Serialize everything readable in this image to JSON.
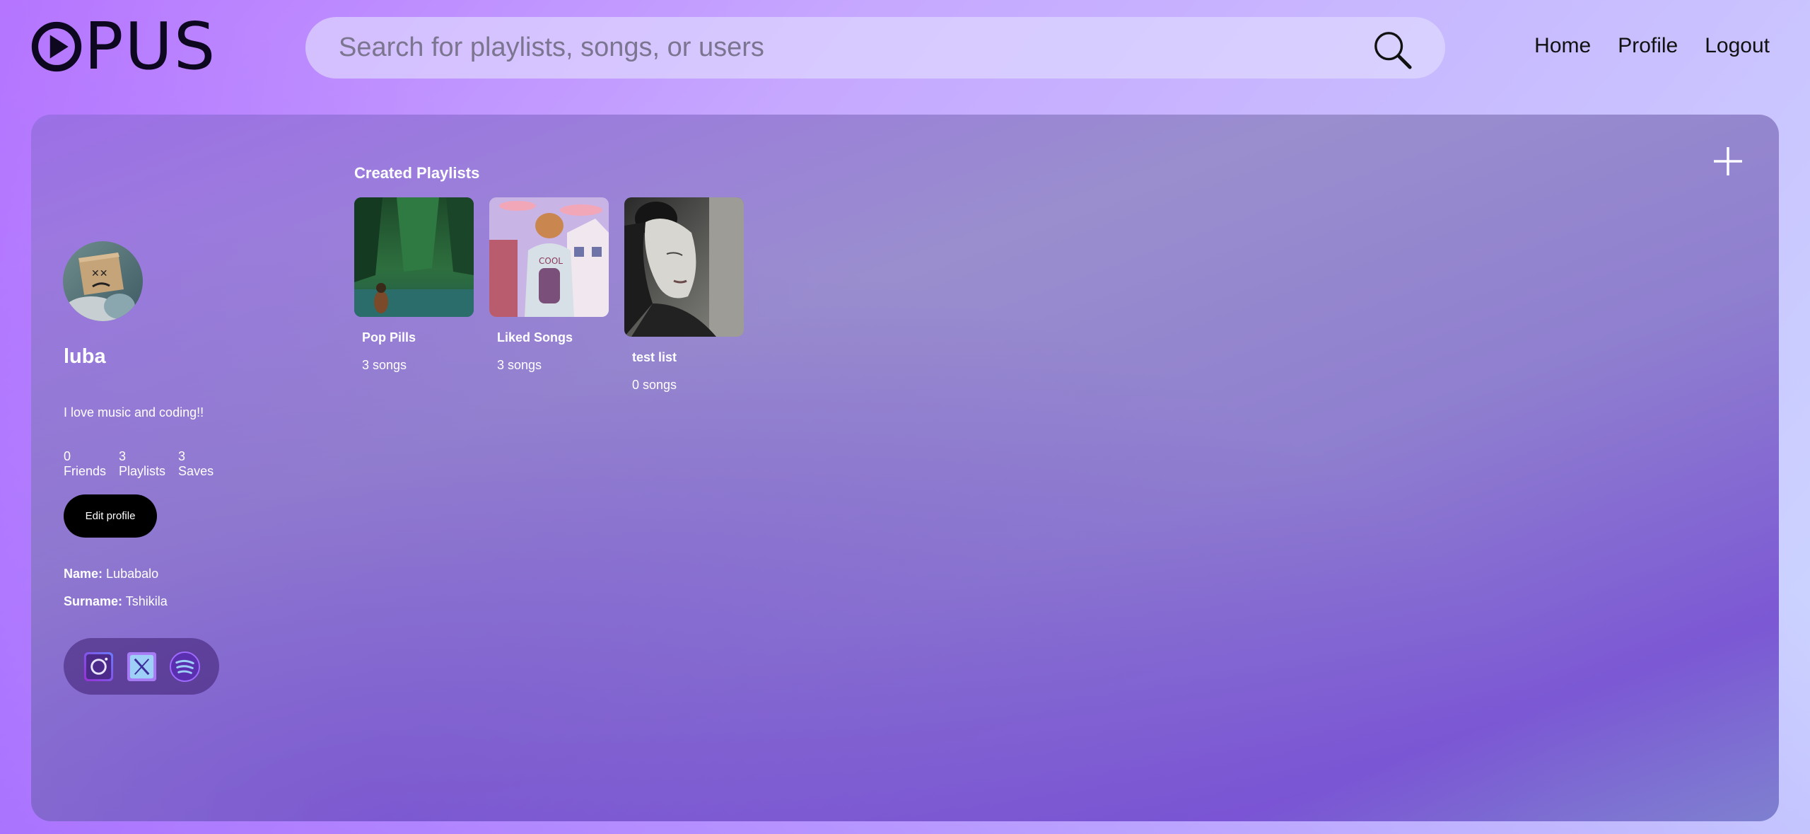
{
  "header": {
    "logo_text": "PUS",
    "search_placeholder": "Search for playlists, songs, or users",
    "nav": [
      "Home",
      "Profile",
      "Logout"
    ]
  },
  "profile": {
    "username": "luba",
    "bio": "I love music and coding!!",
    "stats": [
      {
        "value": "0",
        "label": "Friends"
      },
      {
        "value": "3",
        "label": "Playlists"
      },
      {
        "value": "3",
        "label": "Saves"
      }
    ],
    "edit_label": "Edit profile",
    "name_label": "Name:",
    "name_value": "Lubabalo",
    "surname_label": "Surname:",
    "surname_value": "Tshikila",
    "socials": [
      "instagram-icon",
      "x-twitter-icon",
      "spotify-icon"
    ]
  },
  "playlists": {
    "title": "Created Playlists",
    "items": [
      {
        "name": "Pop Pills",
        "count": "3 songs"
      },
      {
        "name": "Liked Songs",
        "count": "3 songs"
      },
      {
        "name": "test list",
        "count": "0 songs"
      }
    ]
  },
  "colors": {
    "accent": "#9b6ce4",
    "button": "#000000"
  }
}
